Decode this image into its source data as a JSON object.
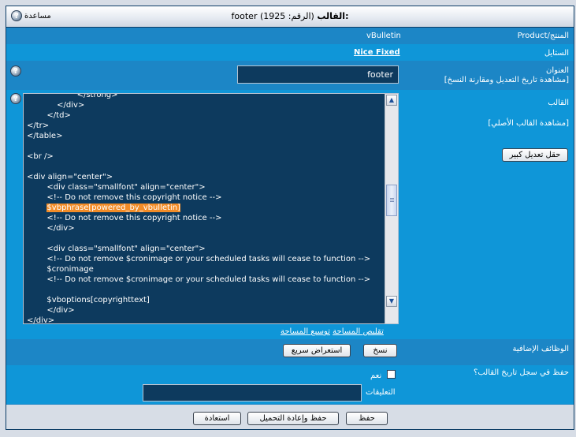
{
  "window": {
    "title_prefix": "القالب:",
    "title_rest": "footer (الرقم: 1925)",
    "help_label": "مساعدة"
  },
  "form": {
    "product": {
      "label": "المنتج/Product",
      "value": "vBulletin"
    },
    "style": {
      "label": "الستايل",
      "value": "Nice Fixed"
    },
    "name": {
      "label": "العنوان",
      "link": "[مشاهدة تاريخ التعديل ومقارنة النسخ]",
      "value": "footer"
    },
    "template": {
      "label": "القالب",
      "view_original": "[مشاهدة القالب الأصلي]",
      "large_edit_button": "حقل تعديل كبير",
      "enlarge_link": "توسيع المساحة",
      "shrink_link": "تقليص المساحة",
      "code_lines": [
        "                    </strong>",
        "            </div>",
        "        </td>",
        "</tr>",
        "</table>",
        "",
        "<br />",
        "",
        "<div align=\"center\">",
        "        <div class=\"smallfont\" align=\"center\">",
        "        <!-- Do not remove this copyright notice -->",
        "        $vbphrase[powered_by_vbulletin]",
        "        <!-- Do not remove this copyright notice -->",
        "        </div>",
        "",
        "        <div class=\"smallfont\" align=\"center\">",
        "        <!-- Do not remove $cronimage or your scheduled tasks will cease to function -->",
        "        $cronimage",
        "        <!-- Do not remove $cronimage or your scheduled tasks will cease to function -->",
        "",
        "        $vboptions[copyrighttext]",
        "        </div>",
        "</div>"
      ]
    },
    "extra_functions": {
      "label": "الوظائف الإضافية",
      "copy_button": "نسخ",
      "preview_button": "استعراض سريع"
    },
    "save_history": {
      "label": "حفظ في سجل تاريخ القالب؟",
      "yes_label": "نعم",
      "comments_label": "التعليقات",
      "comments_value": ""
    }
  },
  "footer": {
    "save": "حفظ",
    "save_reload": "حفظ وإعادة التحميل",
    "reset": "استعادة"
  },
  "colors": {
    "panel": "#1c86c6",
    "alt_row": "#0f96d8",
    "field": "#0d3a5e",
    "highlight": "#f28c28"
  },
  "icons": {
    "help": "help-icon",
    "up": "scroll-up-icon",
    "down": "scroll-down-icon"
  }
}
